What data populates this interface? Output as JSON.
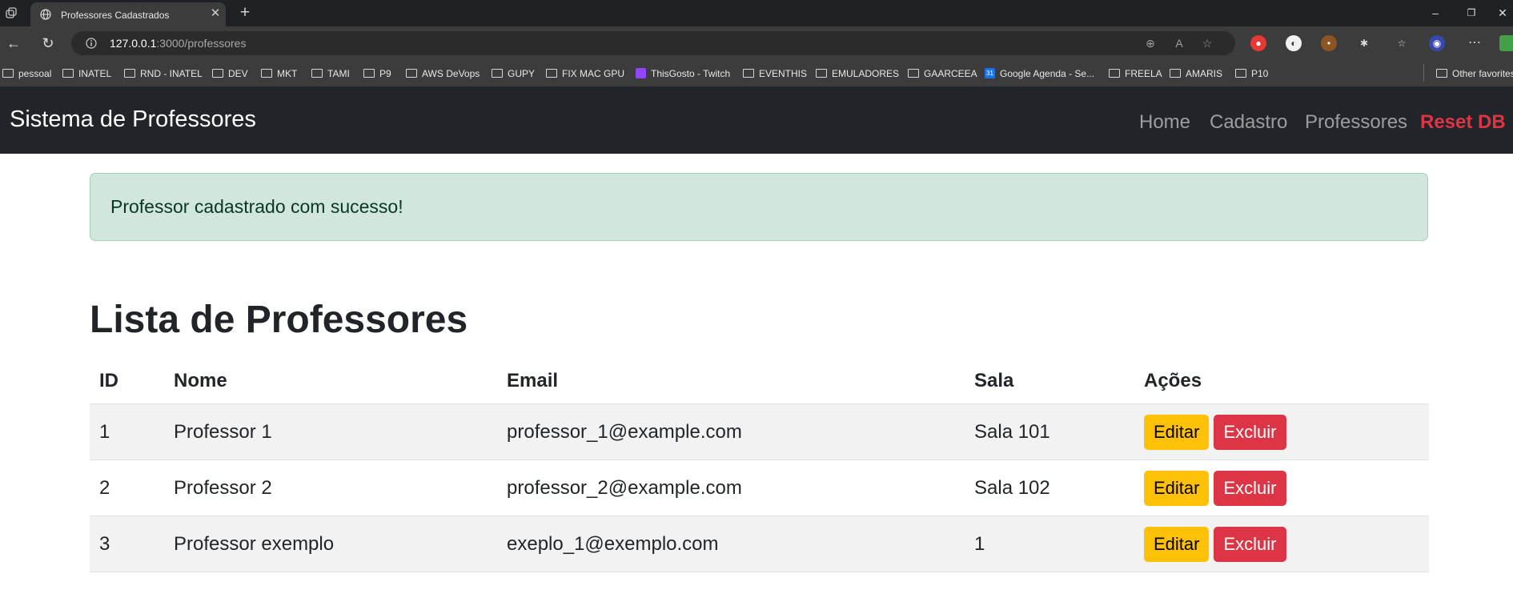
{
  "browser": {
    "tab_title": "Professores Cadastrados",
    "url_host": "127.0.0.1",
    "url_path": ":3000/professores",
    "bookmarks": [
      "pessoal",
      "INATEL",
      "RND - INATEL",
      "DEV",
      "MKT",
      "TAMI",
      "P9",
      "AWS DeVops",
      "GUPY",
      "FIX MAC GPU",
      "ThisGosto - Twitch",
      "EVENTHIS",
      "EMULADORES",
      "GAARCEEA",
      "Google Agenda - Se...",
      "FREELA",
      "AMARIS",
      "P10"
    ],
    "other_favorites": "Other favorites"
  },
  "navbar": {
    "brand": "Sistema de Professores",
    "links": [
      "Home",
      "Cadastro",
      "Professores",
      "Reset DB"
    ]
  },
  "alert": {
    "message": "Professor cadastrado com sucesso!"
  },
  "page": {
    "title": "Lista de Professores"
  },
  "table": {
    "headers": [
      "ID",
      "Nome",
      "Email",
      "Sala",
      "Ações"
    ],
    "rows": [
      {
        "id": "1",
        "nome": "Professor 1",
        "email": "professor_1@example.com",
        "sala": "Sala 101"
      },
      {
        "id": "2",
        "nome": "Professor 2",
        "email": "professor_2@example.com",
        "sala": "Sala 102"
      },
      {
        "id": "3",
        "nome": "Professor exemplo",
        "email": "exeplo_1@exemplo.com",
        "sala": "1"
      }
    ],
    "edit_label": "Editar",
    "delete_label": "Excluir"
  }
}
